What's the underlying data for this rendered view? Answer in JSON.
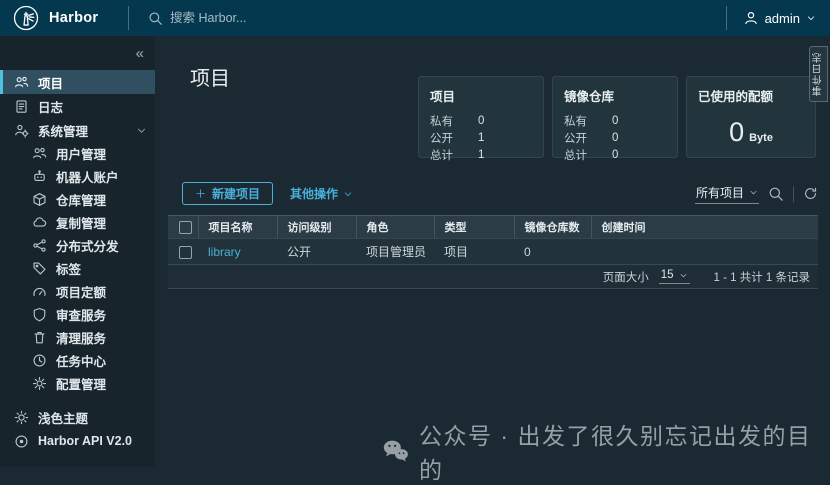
{
  "header": {
    "brand": "Harbor",
    "search_placeholder": "搜索 Harbor...",
    "username": "admin"
  },
  "event_tab": {
    "label": "事件日志"
  },
  "sidebar": {
    "collapse_icon": "«",
    "items": [
      {
        "label": "项目",
        "icon": "projects",
        "selected": true
      },
      {
        "label": "日志",
        "icon": "logs"
      },
      {
        "label": "系统管理",
        "icon": "administration",
        "expanded": true
      }
    ],
    "admin_children": [
      {
        "label": "用户管理",
        "icon": "users"
      },
      {
        "label": "机器人账户",
        "icon": "robot"
      },
      {
        "label": "仓库管理",
        "icon": "registries"
      },
      {
        "label": "复制管理",
        "icon": "replication"
      },
      {
        "label": "分布式分发",
        "icon": "distribution"
      },
      {
        "label": "标签",
        "icon": "labels"
      },
      {
        "label": "项目定额",
        "icon": "quotas"
      },
      {
        "label": "审查服务",
        "icon": "interrogation"
      },
      {
        "label": "清理服务",
        "icon": "garbage-collection"
      },
      {
        "label": "任务中心",
        "icon": "job-center"
      },
      {
        "label": "配置管理",
        "icon": "configuration"
      }
    ],
    "footer_items": [
      {
        "label": "浅色主题",
        "icon": "light-theme"
      },
      {
        "label": "Harbor API V2.0",
        "icon": "api"
      }
    ]
  },
  "main": {
    "title": "项目",
    "summary_cards": [
      {
        "title": "项目",
        "rows": [
          {
            "label": "私有",
            "value": "0"
          },
          {
            "label": "公开",
            "value": "1"
          },
          {
            "label": "总计",
            "value": "1"
          }
        ]
      },
      {
        "title": "镜像仓库",
        "rows": [
          {
            "label": "私有",
            "value": "0"
          },
          {
            "label": "公开",
            "value": "0"
          },
          {
            "label": "总计",
            "value": "0"
          }
        ]
      },
      {
        "title": "已使用的配额",
        "big_value": "0",
        "unit": "Byte"
      }
    ],
    "toolbar": {
      "new_project_label": "新建项目",
      "other_actions_label": "其他操作",
      "project_filter_label": "所有项目"
    },
    "table": {
      "columns": [
        "项目名称",
        "访问级别",
        "角色",
        "类型",
        "镜像仓库数",
        "创建时间"
      ],
      "rows": [
        {
          "name": "library",
          "access_level": "公开",
          "role": "项目管理员",
          "type": "项目",
          "repo_count": "0",
          "creation_time": ""
        }
      ]
    },
    "pagination": {
      "page_size_label": "页面大小",
      "page_size": "15",
      "range_text": "1 - 1 共计 1 条记录"
    }
  },
  "watermark": {
    "text": "公众号 · 出发了很久别忘记出发的目的"
  },
  "colors": {
    "accent": "#49afd9",
    "header_bg": "#04384e",
    "sidebar_bg": "#17242b",
    "content_bg": "#1b2a32",
    "card_bg": "#22343c",
    "selected_nav_bg": "#305062",
    "table_header_bg": "#2b3c46"
  }
}
